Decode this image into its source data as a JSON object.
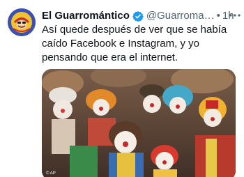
{
  "tweet": {
    "author_name": "El Guarromántico",
    "handle": "@Guarroma…",
    "separator": "•",
    "time": "1h",
    "text": "Así quede después de ver que se había caído Facebook e Instagram, y yo pensando que era el internet.",
    "photo_credit": "© AP"
  },
  "icons": {
    "avatar": "avatar",
    "verified": "verified-badge-icon",
    "more": "more-options-icon"
  },
  "colors": {
    "verified": "#1d9bf0",
    "text": "#0f1419",
    "secondary": "#536471"
  }
}
